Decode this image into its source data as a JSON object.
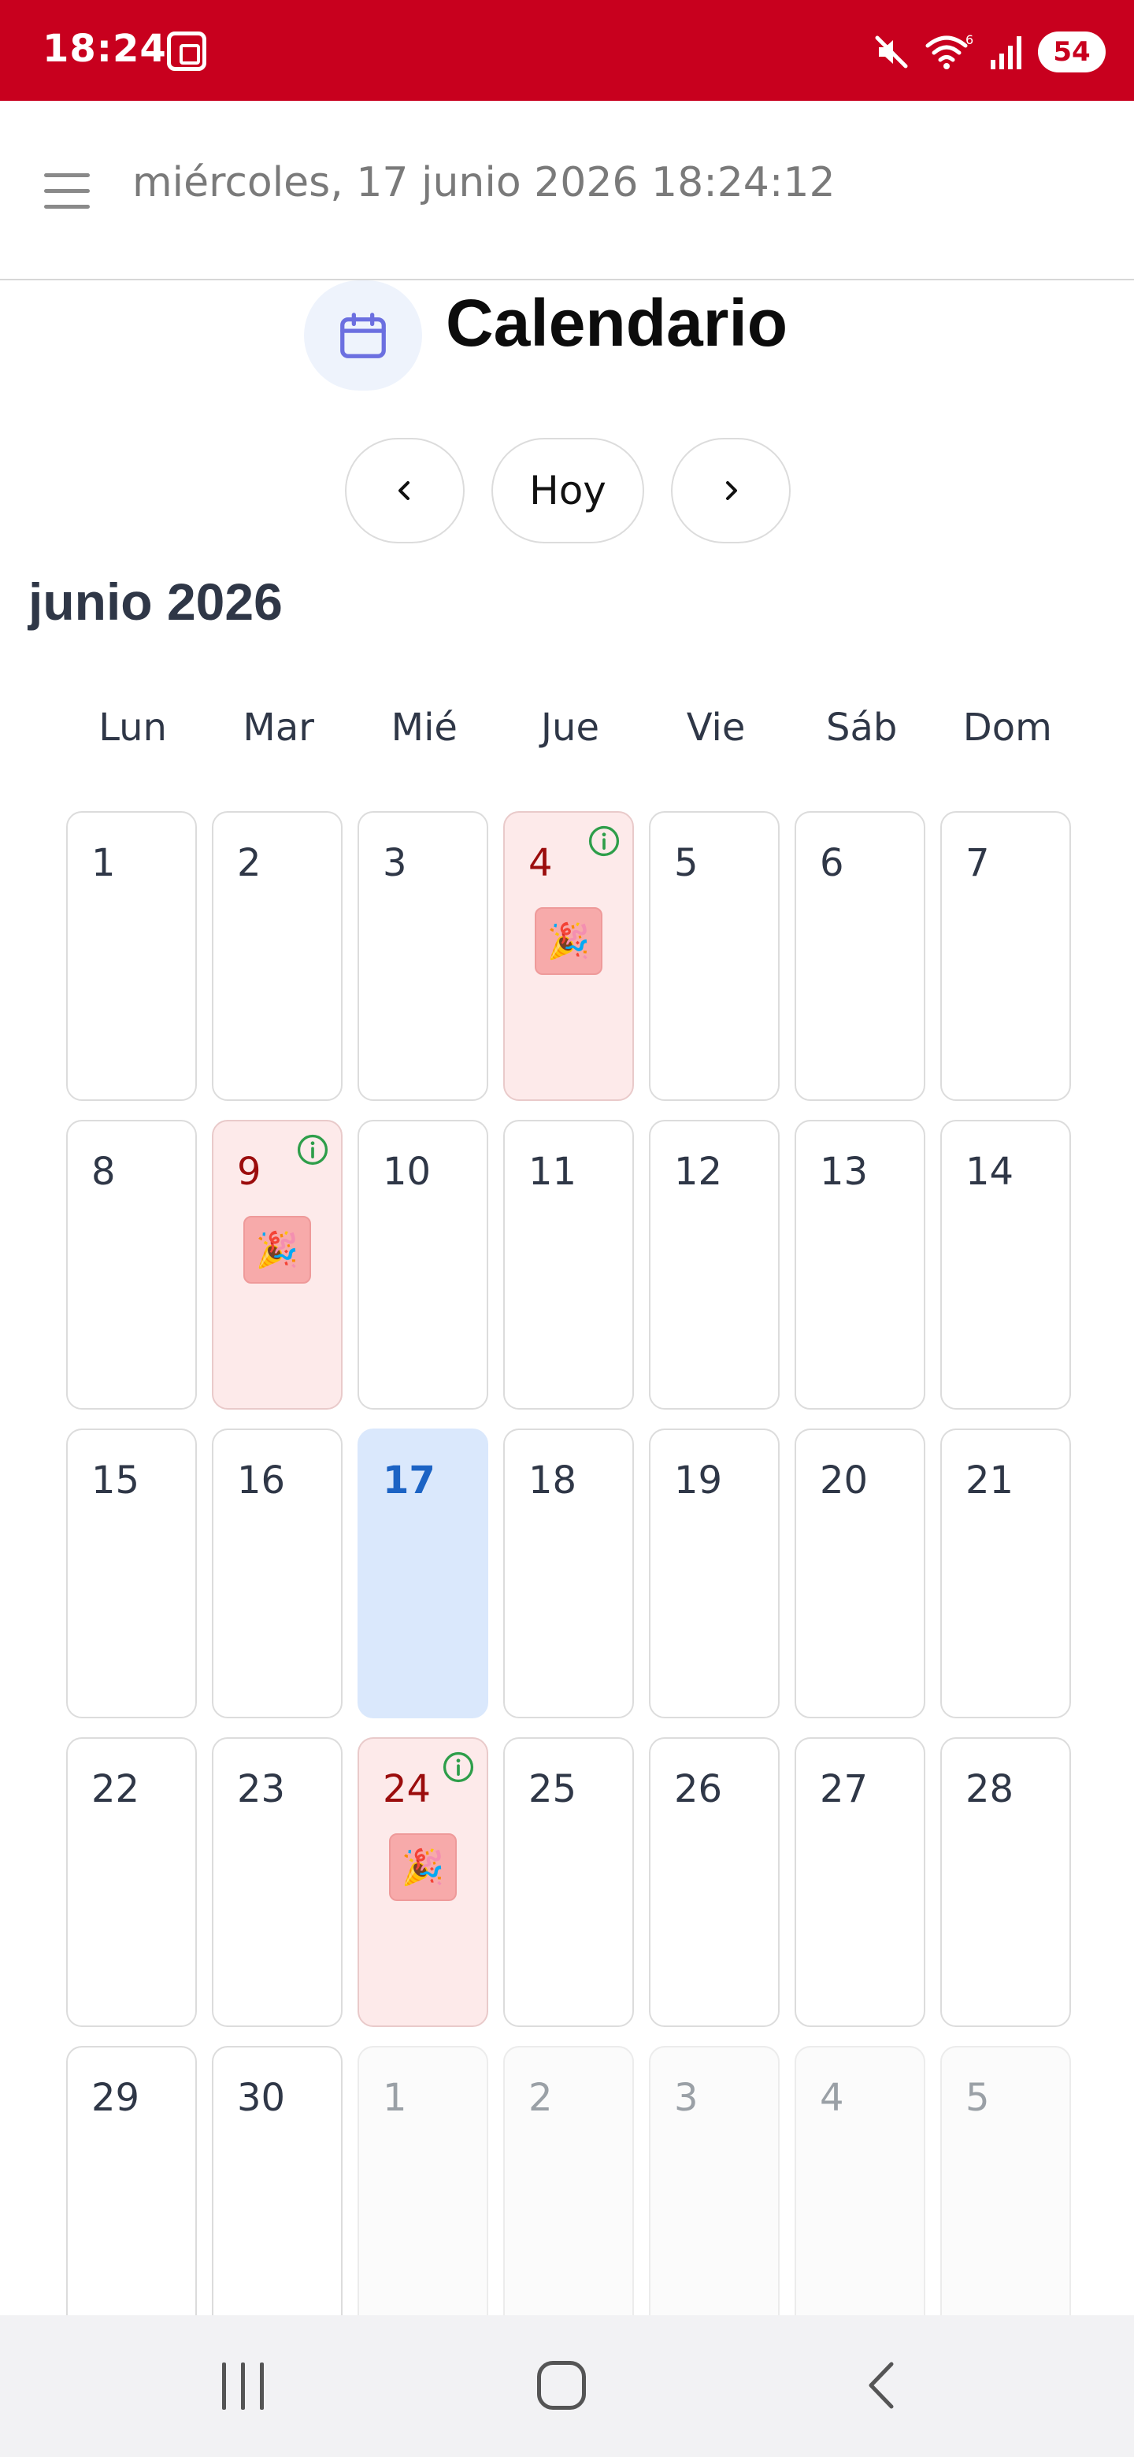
{
  "status_bar": {
    "time": "18:24",
    "battery": "54",
    "wifi_badge": "6"
  },
  "header": {
    "datetime": "miércoles, 17 junio 2026 18:24:12"
  },
  "page": {
    "title": "Calendario"
  },
  "nav": {
    "prev": "‹",
    "today": "Hoy",
    "next": "›"
  },
  "month_label": "junio 2026",
  "weekdays": [
    "Lun",
    "Mar",
    "Mié",
    "Jue",
    "Vie",
    "Sáb",
    "Dom"
  ],
  "days": [
    {
      "n": "1"
    },
    {
      "n": "2"
    },
    {
      "n": "3"
    },
    {
      "n": "4",
      "event": true
    },
    {
      "n": "5"
    },
    {
      "n": "6"
    },
    {
      "n": "7"
    },
    {
      "n": "8"
    },
    {
      "n": "9",
      "event": true
    },
    {
      "n": "10"
    },
    {
      "n": "11"
    },
    {
      "n": "12"
    },
    {
      "n": "13"
    },
    {
      "n": "14"
    },
    {
      "n": "15"
    },
    {
      "n": "16"
    },
    {
      "n": "17",
      "today": true
    },
    {
      "n": "18"
    },
    {
      "n": "19"
    },
    {
      "n": "20"
    },
    {
      "n": "21"
    },
    {
      "n": "22"
    },
    {
      "n": "23"
    },
    {
      "n": "24",
      "event": true
    },
    {
      "n": "25"
    },
    {
      "n": "26"
    },
    {
      "n": "27"
    },
    {
      "n": "28"
    },
    {
      "n": "29"
    },
    {
      "n": "30"
    },
    {
      "n": "1",
      "other": true
    },
    {
      "n": "2",
      "other": true
    },
    {
      "n": "3",
      "other": true
    },
    {
      "n": "4",
      "other": true
    },
    {
      "n": "5",
      "other": true
    }
  ],
  "event_icon": "🎉",
  "colors": {
    "status_bar": "#c8001e",
    "event_bg": "#fdeaea",
    "event_text": "#9b0d0d",
    "today_bg": "#dae8fc",
    "today_text": "#1c63c4",
    "info_icon": "#2e9e4a",
    "calendar_icon": "#6b6fe0"
  }
}
